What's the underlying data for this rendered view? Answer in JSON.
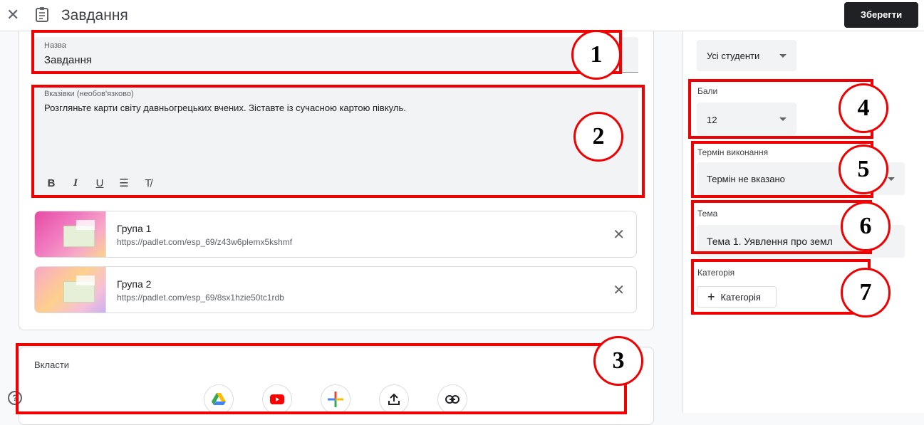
{
  "header": {
    "close_icon": "close-icon",
    "doc_icon": "assignment-icon",
    "title": "Завдання",
    "save_label": "Зберегти"
  },
  "form": {
    "title_label": "Назва",
    "title_value": "Завдання",
    "instructions_label": "Вказівки (необов'язково)",
    "instructions_value": "Розгляньте карти світу давньогрецьких вчених. Зіставте із сучасною картою півкуль.",
    "format_buttons": [
      "B",
      "I",
      "U",
      "☰",
      "T̸"
    ]
  },
  "attachments": [
    {
      "title": "Група 1",
      "url": "https://padlet.com/esp_69/z43w6plemx5kshmf"
    },
    {
      "title": "Група 2",
      "url": "https://padlet.com/esp_69/8sx1hzie50tc1rdb"
    }
  ],
  "embed": {
    "label": "Вкласти",
    "buttons": [
      "drive-icon",
      "youtube-icon",
      "create-icon",
      "upload-icon",
      "link-icon"
    ]
  },
  "sidebar": {
    "students_value": "Усі студенти",
    "points_label": "Бали",
    "points_value": "12",
    "due_label": "Термін виконання",
    "due_value": "Термін не вказано",
    "topic_label": "Тема",
    "topic_value": "Тема 1. Уявлення про земл",
    "category_label": "Категорія",
    "category_button": "Категорія"
  },
  "annotations": [
    "1",
    "2",
    "3",
    "4",
    "5",
    "6",
    "7"
  ],
  "colors": {
    "annotation": "#f00000",
    "save_button": "#202124"
  }
}
